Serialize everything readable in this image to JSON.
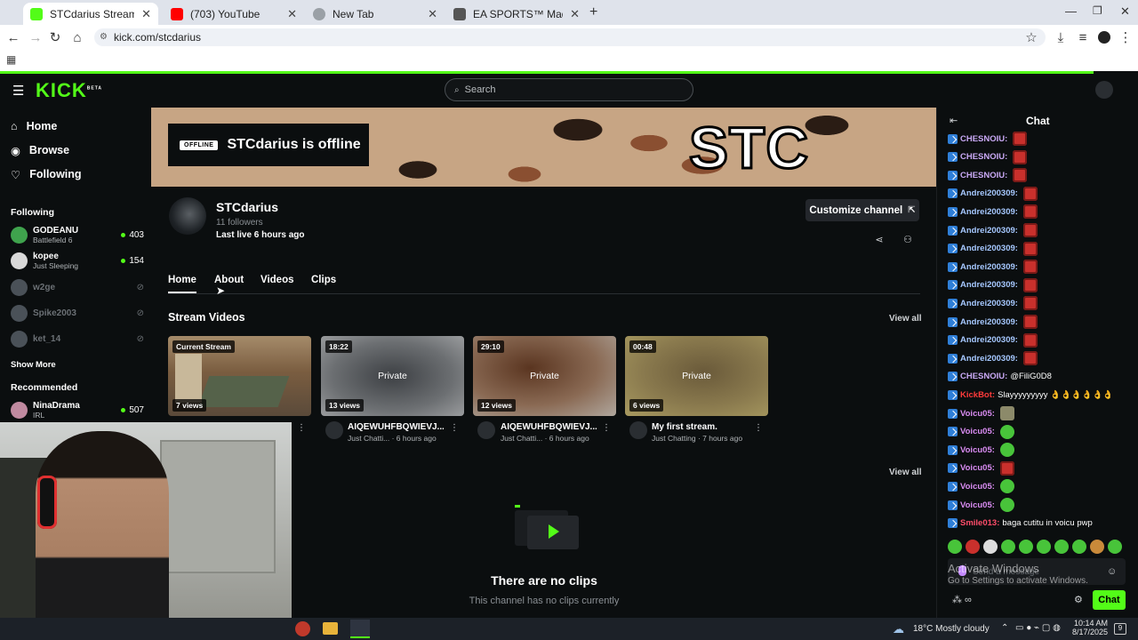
{
  "browser": {
    "tabs": [
      {
        "title": "STCdarius Stream - Watch Live",
        "favicon_color": "#53fc18"
      },
      {
        "title": "(703) YouTube",
        "favicon_color": "#ff0000"
      },
      {
        "title": "New Tab",
        "favicon_color": "#9aa0a6"
      },
      {
        "title": "EA SPORTS™ Madden NFL 26 |",
        "favicon_color": "#555555"
      }
    ],
    "url": "kick.com/stcdarius"
  },
  "header": {
    "logo": "KICK",
    "logo_tag": "BETA",
    "search_placeholder": "Search"
  },
  "sidebar": {
    "nav": [
      {
        "label": "Home",
        "icon": "home-icon"
      },
      {
        "label": "Browse",
        "icon": "compass-icon"
      },
      {
        "label": "Following",
        "icon": "heart-icon"
      }
    ],
    "following_heading": "Following",
    "following": [
      {
        "name": "GODEANU",
        "sub": "Battlefield 6",
        "count": "403",
        "live": true,
        "avatar_color": "#3fa34d"
      },
      {
        "name": "kopee",
        "sub": "Just Sleeping",
        "count": "154",
        "live": true,
        "avatar_color": "#d9d9d9"
      },
      {
        "name": "w2ge",
        "sub": "",
        "count": "",
        "live": false,
        "avatar_color": "#4a5158"
      },
      {
        "name": "Spike2003",
        "sub": "",
        "count": "",
        "live": false,
        "avatar_color": "#4a5158"
      },
      {
        "name": "ket_14",
        "sub": "",
        "count": "",
        "live": false,
        "avatar_color": "#4a5158"
      }
    ],
    "show_more": "Show More",
    "recommended_heading": "Recommended",
    "recommended": [
      {
        "name": "NinaDrama",
        "sub": "IRL",
        "count": "507",
        "live": true,
        "avatar_color": "#c08aa0"
      }
    ]
  },
  "banner": {
    "offline_badge": "OFFLINE",
    "offline_title": "STCdarius is offline",
    "banner_text": "STC"
  },
  "channel": {
    "name": "STCdarius",
    "followers": "11 followers",
    "last_live": "Last live 6 hours ago",
    "customize_label": "Customize channel",
    "tabs": [
      "Home",
      "About",
      "Videos",
      "Clips"
    ],
    "stream_videos_heading": "Stream Videos",
    "view_all": "View all",
    "videos": [
      {
        "badge": "Current Stream",
        "views": "7 views",
        "private": "",
        "title": "",
        "sub": "",
        "thumb": "room"
      },
      {
        "badge": "18:22",
        "views": "13 views",
        "private": "Private",
        "title": "AIQEWUHFBQWIEVJ...",
        "sub": "Just Chatti... · 6 hours ago",
        "thumb": "#5a5d60"
      },
      {
        "badge": "29:10",
        "views": "12 views",
        "private": "Private",
        "title": "AIQEWUHFBQWIEVJ...",
        "sub": "Just Chatti... · 6 hours ago",
        "thumb": "#6a4a36"
      },
      {
        "badge": "00:48",
        "views": "6 views",
        "private": "Private",
        "title": "My first stream.",
        "sub": "Just Chatting · 7 hours ago",
        "thumb": "#6e6a4a"
      }
    ],
    "clips_view_all": "View all",
    "no_clips_title": "There are no clips",
    "no_clips_sub": "This channel has no clips currently"
  },
  "chat": {
    "title": "Chat",
    "messages": [
      {
        "user": "CHESNOIU",
        "color": "#c9a9f5",
        "text": "",
        "emote": "red"
      },
      {
        "user": "CHESNOIU",
        "color": "#c9a9f5",
        "text": "",
        "emote": "red"
      },
      {
        "user": "CHESNOIU",
        "color": "#c9a9f5",
        "text": "",
        "emote": "red"
      },
      {
        "user": "Andrei200309",
        "color": "#a6c8ff",
        "text": "",
        "emote": "red"
      },
      {
        "user": "Andrei200309",
        "color": "#a6c8ff",
        "text": "",
        "emote": "red"
      },
      {
        "user": "Andrei200309",
        "color": "#a6c8ff",
        "text": "",
        "emote": "red"
      },
      {
        "user": "Andrei200309",
        "color": "#a6c8ff",
        "text": "",
        "emote": "red"
      },
      {
        "user": "Andrei200309",
        "color": "#a6c8ff",
        "text": "",
        "emote": "red"
      },
      {
        "user": "Andrei200309",
        "color": "#a6c8ff",
        "text": "",
        "emote": "red"
      },
      {
        "user": "Andrei200309",
        "color": "#a6c8ff",
        "text": "",
        "emote": "red"
      },
      {
        "user": "Andrei200309",
        "color": "#a6c8ff",
        "text": "",
        "emote": "red"
      },
      {
        "user": "Andrei200309",
        "color": "#a6c8ff",
        "text": "",
        "emote": "red"
      },
      {
        "user": "Andrei200309",
        "color": "#a6c8ff",
        "text": "",
        "emote": "red"
      },
      {
        "user": "CHESNOIU",
        "color": "#c9a9f5",
        "text": "@FiliG0D8",
        "emote": ""
      },
      {
        "user": "KickBot",
        "color": "#ff3b3b",
        "text": "Slayyyyyyyyy 👌👌👌👌👌👌",
        "emote": ""
      },
      {
        "user": "Voicu05",
        "color": "#d98cf2",
        "text": "",
        "emote": "pic"
      },
      {
        "user": "Voicu05",
        "color": "#d98cf2",
        "text": "",
        "emote": "green"
      },
      {
        "user": "Voicu05",
        "color": "#d98cf2",
        "text": "",
        "emote": "green"
      },
      {
        "user": "Voicu05",
        "color": "#d98cf2",
        "text": "",
        "emote": "red"
      },
      {
        "user": "Voicu05",
        "color": "#d98cf2",
        "text": "",
        "emote": "green"
      },
      {
        "user": "Voicu05",
        "color": "#d98cf2",
        "text": "",
        "emote": "green"
      },
      {
        "user": "Smile013",
        "color": "#ff4d6a",
        "text": "baga cutitu in voicu pwp",
        "emote": ""
      }
    ],
    "input_placeholder": "Send a message",
    "send_label": "Chat",
    "activate_title": "Activate Windows",
    "activate_sub": "Go to Settings to activate Windows."
  },
  "taskbar": {
    "weather": "18°C  Mostly cloudy",
    "time": "10:14 AM",
    "date": "8/17/2025",
    "notifications": "9"
  }
}
